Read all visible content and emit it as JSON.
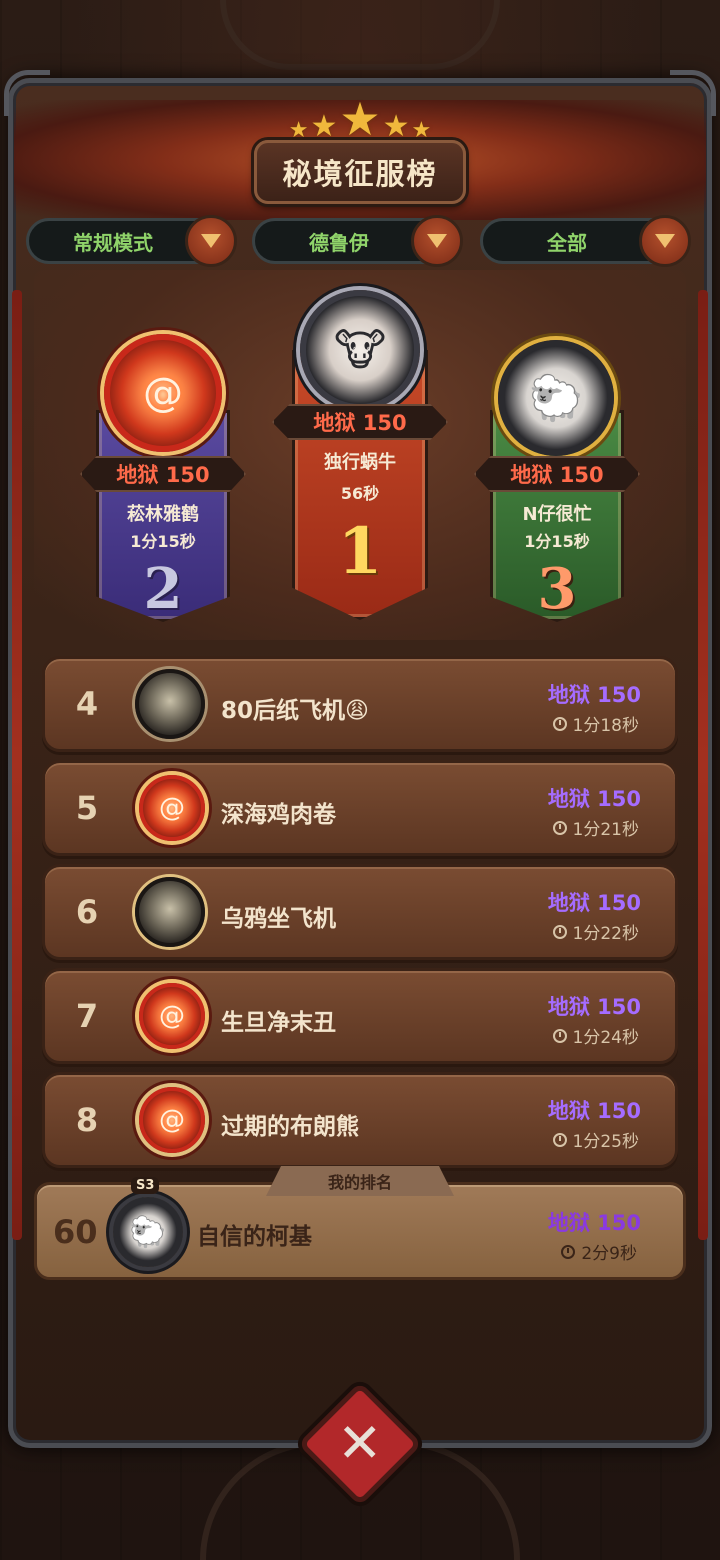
{
  "title": "秘境征服榜",
  "filters": [
    {
      "label": "常规模式"
    },
    {
      "label": "德鲁伊"
    },
    {
      "label": "全部"
    }
  ],
  "podium": {
    "first": {
      "rank": "1",
      "level": "地狱 150",
      "name": "独行蜗牛",
      "time": "56秒"
    },
    "second": {
      "rank": "2",
      "level": "地狱 150",
      "name": "菘林雅鹤",
      "time": "1分15秒"
    },
    "third": {
      "rank": "3",
      "level": "地狱 150",
      "name": "N仔很忙",
      "time": "1分15秒"
    }
  },
  "rows": [
    {
      "rank": "4",
      "name": "80后纸飞机😩",
      "level": "地狱 150",
      "time": "1分18秒",
      "avatar": "dark-mask-icon"
    },
    {
      "rank": "5",
      "name": "深海鸡肉卷",
      "level": "地狱 150",
      "time": "1分21秒",
      "avatar": "fire-swirl-icon"
    },
    {
      "rank": "6",
      "name": "乌鸦坐飞机",
      "level": "地狱 150",
      "time": "1分22秒",
      "avatar": "winged-mask-icon"
    },
    {
      "rank": "7",
      "name": "生旦净末丑",
      "level": "地狱 150",
      "time": "1分24秒",
      "avatar": "fire-swirl-icon"
    },
    {
      "rank": "8",
      "name": "过期的布朗熊",
      "level": "地狱 150",
      "time": "1分25秒",
      "avatar": "winged-swirl-icon"
    }
  ],
  "my_rank": {
    "tab_label": "我的排名",
    "rank": "60",
    "season": "S3",
    "name": "自信的柯基",
    "level": "地狱 150",
    "time": "2分9秒"
  },
  "close_icon": "close-icon",
  "colors": {
    "level_purple": "#a56cff",
    "level_red": "#ff6a4a",
    "filter_green": "#8fd36a",
    "close_red": "#b2282a"
  }
}
